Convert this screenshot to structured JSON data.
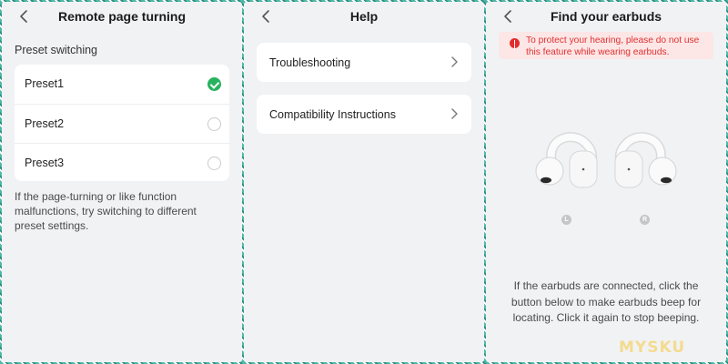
{
  "remote_page_turning": {
    "title": "Remote page turning",
    "section_label": "Preset switching",
    "presets": [
      {
        "label": "Preset1",
        "selected": true
      },
      {
        "label": "Preset2",
        "selected": false
      },
      {
        "label": "Preset3",
        "selected": false
      }
    ],
    "hint": "If the page-turning or like function malfunctions, try switching to different preset settings."
  },
  "help": {
    "title": "Help",
    "items": [
      {
        "label": "Troubleshooting"
      },
      {
        "label": "Compatibility Instructions"
      }
    ]
  },
  "find_earbuds": {
    "title": "Find your earbuds",
    "warning": "To protect your hearing, please do not use this feature while wearing earbuds.",
    "left_marker": "L",
    "right_marker": "R",
    "description": "If the earbuds are connected, click the button below to make earbuds beep for locating. Click it again to stop beeping."
  },
  "watermark": "MYSKU",
  "colors": {
    "selected_green": "#27b35d",
    "warning_red": "#e03131",
    "warning_bg": "#fde6e6",
    "panel_bg": "#f1f2f4"
  },
  "icons": {
    "back": "chevron-left-icon",
    "disclosure": "chevron-right-icon",
    "warning": "exclamation-circle-icon"
  }
}
